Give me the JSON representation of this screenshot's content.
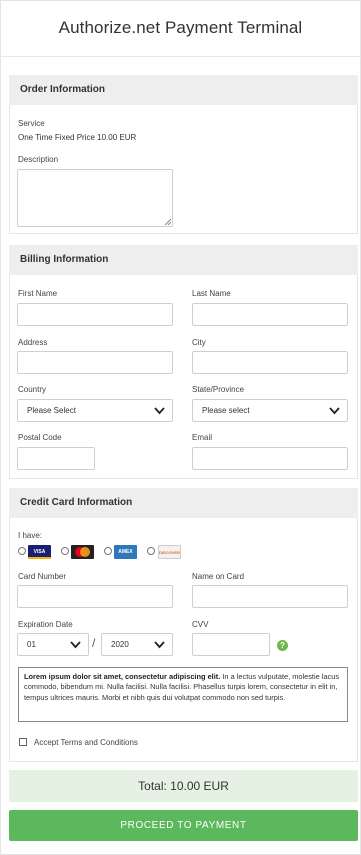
{
  "header": {
    "title": "Authorize.net Payment Terminal"
  },
  "order": {
    "section_title": "Order Information",
    "service_label": "Service",
    "service_value": "One Time Fixed Price 10.00 EUR",
    "description_label": "Description"
  },
  "billing": {
    "section_title": "Billing Information",
    "first_name_label": "First Name",
    "last_name_label": "Last Name",
    "address_label": "Address",
    "city_label": "City",
    "country_label": "Country",
    "country_value": "Please Select",
    "state_label": "State/Province",
    "state_value": "Please select",
    "postal_label": "Postal Code",
    "email_label": "Email"
  },
  "card": {
    "section_title": "Credit Card Information",
    "i_have_label": "I have:",
    "logos": [
      {
        "name": "VISA",
        "bg": "#1a1f71",
        "fg": "#ffffff"
      },
      {
        "name": "MasterCard",
        "bg": "#222222",
        "fg": "#ffffff"
      },
      {
        "name": "AMEX",
        "bg": "#2e77bb",
        "fg": "#ffffff"
      },
      {
        "name": "DISCOVER",
        "bg": "#f2f2f2",
        "fg": "#e06c1d"
      }
    ],
    "card_number_label": "Card Number",
    "name_on_card_label": "Name on Card",
    "expiration_label": "Expiration Date",
    "exp_month": "01",
    "exp_separator": "/",
    "exp_year": "2020",
    "cvv_label": "CVV",
    "help_icon": "?"
  },
  "notice": {
    "bold_text": "Lorem ipsum dolor sit amet, consectetur adipiscing elit.",
    "body_text": " In a lectus vulputate, molestie lacus commodo, bibendum mi. Nulla facilisi. Nulla facilisi. Phasellus turpis lorem, consectetur in elit in, tempus ultrices mauris. Morbi et nibh quis dui volutpat commodo non sed turpis."
  },
  "terms": {
    "label": "Accept Terms and Conditions"
  },
  "total": {
    "label": "Total:  10.00  EUR"
  },
  "submit": {
    "label": "PROCEED TO PAYMENT"
  },
  "colors": {
    "accent_green": "#5cb85c",
    "total_bg": "#e4f1e3",
    "section_bg": "#eeeeee"
  }
}
